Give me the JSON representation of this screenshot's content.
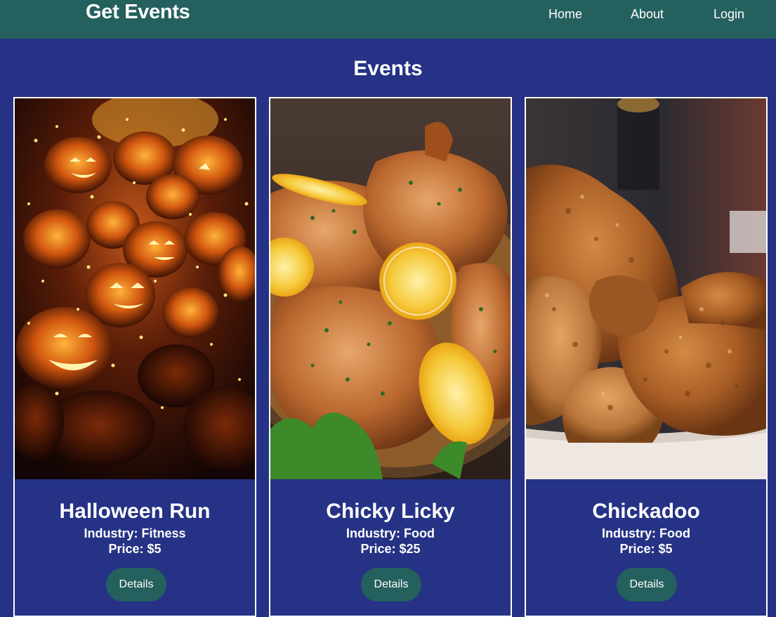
{
  "nav": {
    "brand": "Get Events",
    "links": [
      "Home",
      "About",
      "Login"
    ]
  },
  "page": {
    "heading": "Events"
  },
  "events": [
    {
      "title": "Halloween Run",
      "industry": "Industry: Fitness",
      "price": "Price: $5",
      "button": "Details",
      "image": "jack-o-lanterns photo"
    },
    {
      "title": "Chicky Licky",
      "industry": "Industry: Food",
      "price": "Price: $25",
      "button": "Details",
      "image": "lemon chicken photo"
    },
    {
      "title": "Chickadoo",
      "industry": "Industry: Food",
      "price": "Price: $5",
      "button": "Details",
      "image": "fried chicken photo"
    }
  ],
  "colors": {
    "navbar": "#24605e",
    "background": "#253285",
    "button": "#24605e",
    "text": "#ffffff"
  }
}
